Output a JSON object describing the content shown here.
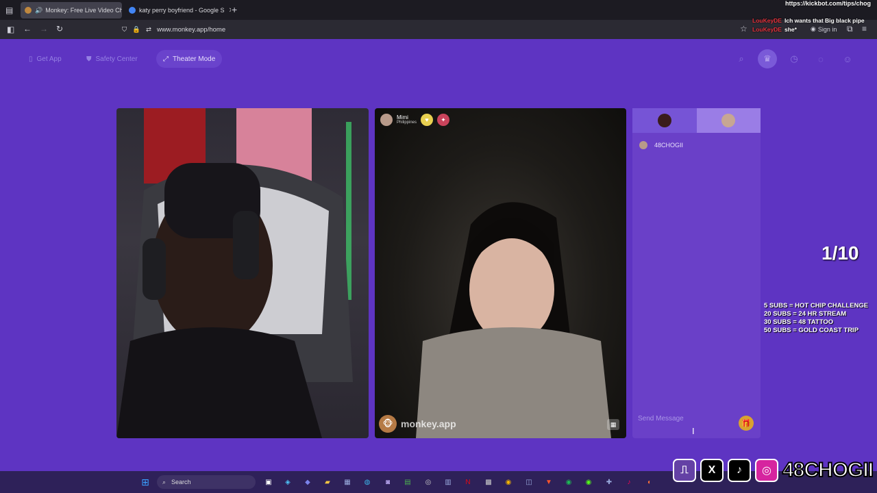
{
  "browser": {
    "tabs": [
      {
        "title": "Monkey: Free Live Video Ch",
        "active": true,
        "favicon_color": "#c0883f"
      },
      {
        "title": "katy perry boyfriend - Google S",
        "active": false,
        "favicon_color": "#4285f4"
      }
    ],
    "new_tab": "+",
    "url": "www.monkey.app/home",
    "sign_in": "Sign in"
  },
  "overlay_chat": {
    "link": "https://kickbot.com/tips/chog",
    "messages": [
      {
        "user": "LouKeyDE",
        "text": "Ich wants that Big black pipe"
      },
      {
        "user": "LouKeyDE",
        "text": "she*"
      }
    ]
  },
  "site_header": {
    "get_app": "Get App",
    "safety_center": "Safety Center",
    "theater_mode": "Theater Mode",
    "icons": [
      "search-icon",
      "crown-icon",
      "history-icon",
      "chat-icon",
      "profile-icon"
    ]
  },
  "match": {
    "name": "Mimi",
    "country": "Philippines",
    "watermark": "monkey.app"
  },
  "chat": {
    "username": "48CHOGII",
    "placeholder": "Send Message"
  },
  "stream": {
    "counter": "1/10",
    "goals": [
      "5 SUBS = HOT CHIP CHALLENGE",
      "20 SUBS = 24 HR STREAM",
      "30 SUBS = 48 TATTOO",
      "50 SUBS = GOLD COAST TRIP"
    ],
    "handle": "48CHOGII"
  },
  "taskbar": {
    "search": "Search"
  },
  "colors": {
    "page_bg": "#5e34c2",
    "chat_bg": "#6a40c8",
    "accent": "#d9a230"
  }
}
